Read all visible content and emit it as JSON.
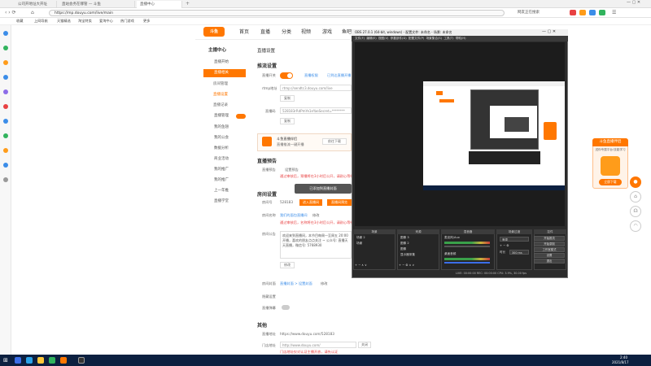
{
  "browser": {
    "tabs": [
      "公司开地址大开址",
      "直站会务在哪管 — 斗鱼",
      "直播中心"
    ],
    "url": "https://mp.douyu.com/live/main",
    "search_hint": "网友正在搜索",
    "bookmarks": [
      "收藏",
      "上网导航",
      "天猫精选",
      "淘宝特卖",
      "爱淘中心",
      "热门游戏",
      "更多"
    ]
  },
  "site": {
    "logo": "斗鱼",
    "nav": [
      "首页",
      "直播",
      "分类",
      "视频",
      "游戏",
      "鱼吧"
    ],
    "sidebar_title": "主播中心",
    "sidebar_items": [
      "直播开始",
      "直播相关",
      "直播管理",
      "我的鱼翅",
      "我的公会",
      "数据分析",
      "商业活动",
      "我的推广",
      "我的推广",
      "上一年推",
      "直播学堂"
    ],
    "sidebar_sub": [
      "房间管理",
      "直播设置",
      "直播记录"
    ],
    "breadcrumb": "直播设置",
    "section_push": "推流设置",
    "push_switch_label": "直播开关",
    "push_link_1": "直播权限",
    "push_link_2": "已到达直播开播",
    "rtmp_label": "rtmp地址",
    "rtmp_value": "rtmp://sendtc3.douyu.com/live",
    "copy_label": "复制",
    "code_label": "直播码",
    "code_value": "528183rRdPmYe1eYaeSecret=********",
    "ad_title": "斗鱼直播伴侣",
    "ad_sub": "直播推流一键开播",
    "ad_btn": "前往下载",
    "section_notice": "直播预告",
    "notice_label": "直播预告",
    "notice_btn": "设置预告",
    "notice_warn": "通过审核后，预播将在3小时后公开，请耐心等待",
    "popup": "已添加到直播封面",
    "section_room": "房间设置",
    "room_id_label": "房间号",
    "room_id_value": "528183",
    "room_btn_1": "进入直播间",
    "room_btn_2": "直播间预览",
    "room_name_label": "房间名称",
    "room_name_value": "我们的面包直播间",
    "room_edit": "修改",
    "room_name_warn": "通过审核后，名称将在3小时后公开，请耐心等待",
    "announce_label": "房间公告",
    "announce_text": "欢迎来到直播间，本节目每周一至周五 20:00 开播，喜欢的朋友点点关注 ~ 公众号: 直播天天直播，微信号: 5768930",
    "announce_btn": "修改",
    "cover_label": "房间封面",
    "cover_link": "直播封面 > 设置封面",
    "cover_edit": "修改",
    "hide_label": "隐藏设置",
    "barrage_label": "直播弹幕",
    "section_other": "其他",
    "share_label": "直播地址",
    "share_value": "https://www.douyu.com/528183",
    "plugin_label": "门店地址",
    "plugin_value": "http://www.douyu.com/",
    "plugin_btn": "关闭",
    "plugin_warn": "门店地址仅对认证主播开放，请先认证"
  },
  "obs": {
    "title": "OBS 27.0.1 (64-bit, windows) - 配置文件: 未命名 - 场景: 未命名",
    "menu": [
      "文件(F)",
      "编辑(E)",
      "视图(V)",
      "停靠部件(D)",
      "配置文件(P)",
      "场景集合(S)",
      "工具(T)",
      "帮助(H)"
    ],
    "docks": [
      "场景",
      "来源",
      "混音器",
      "场景过渡",
      "控件"
    ],
    "scenes": [
      "场景 2",
      "场景"
    ],
    "sources": [
      "图像 3",
      "图像 2",
      "图像",
      "显示器采集"
    ],
    "mixer": [
      "麦克风/Aux",
      "桌面音频"
    ],
    "transition": "渐变",
    "duration_label": "时长",
    "duration_value": "300 ms",
    "controls": [
      "开始推流",
      "开始录制",
      "工作室模式",
      "设置",
      "退出"
    ],
    "status": "LIVE: 00:00:00   REC: 00:00:00   CPU: 3.9%, 30.00 fps"
  },
  "promo": {
    "title": "斗鱼直播伴侣",
    "sub": "送你专属平台·技能学习",
    "btn": "立即下载"
  },
  "taskbar": {
    "time": "2:40",
    "date": "2021/8/17"
  }
}
